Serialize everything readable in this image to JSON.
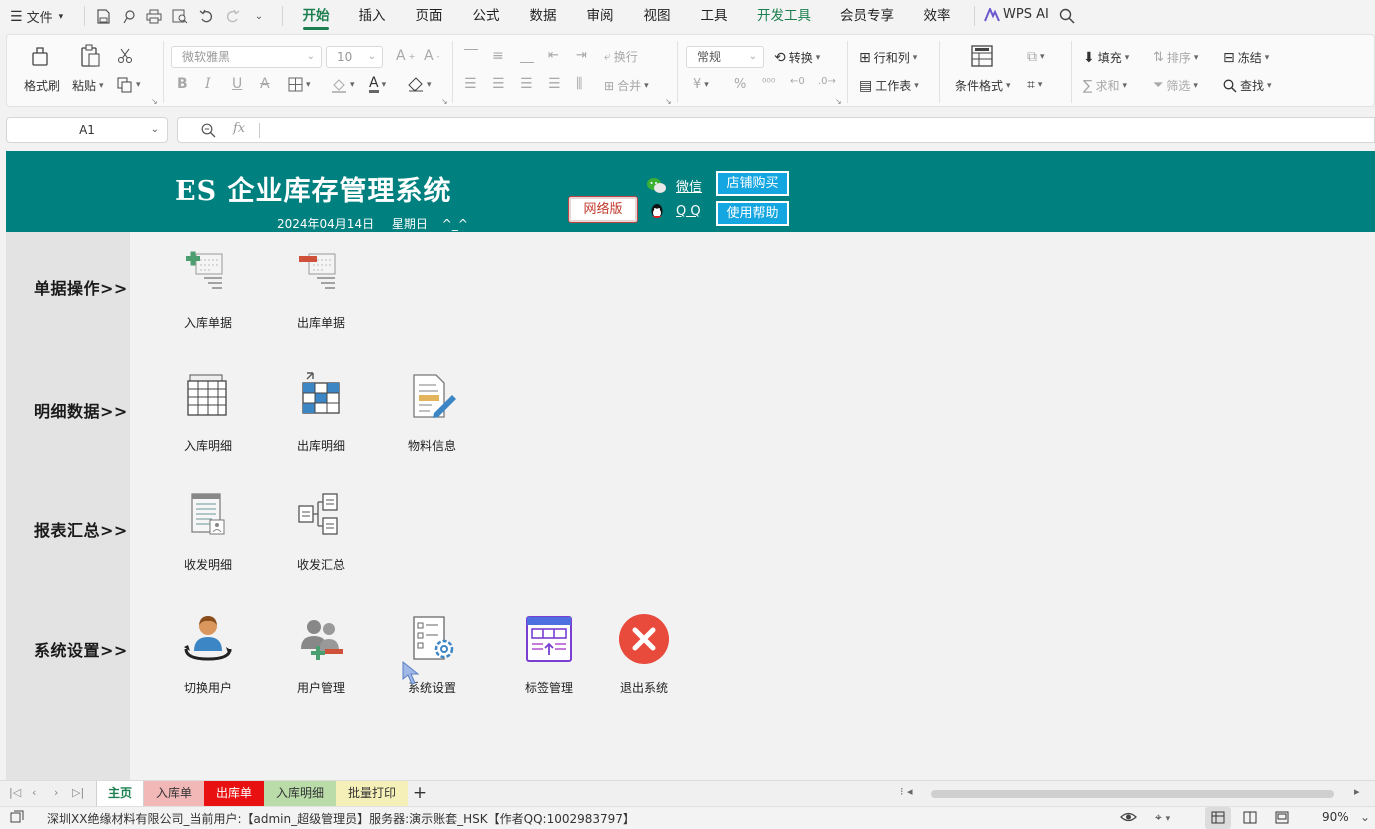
{
  "menubar": {
    "file_label": "文件",
    "tabs": [
      "开始",
      "插入",
      "页面",
      "公式",
      "数据",
      "审阅",
      "视图",
      "工具",
      "开发工具",
      "会员专享",
      "效率"
    ],
    "active_tab": "开始",
    "wps_ai": "WPS AI"
  },
  "ribbon": {
    "format_painter": "格式刷",
    "paste": "粘贴",
    "font_name": "微软雅黑",
    "font_size": "10",
    "wrap": "换行",
    "merge": "合并",
    "number_format": "常规",
    "convert": "转换",
    "rows_cols": "行和列",
    "worksheet": "工作表",
    "cond_format": "条件格式",
    "fill": "填充",
    "sort": "排序",
    "freeze": "冻结",
    "sum": "求和",
    "filter": "筛选",
    "find": "查找",
    "currency_symbol": "¥",
    "percent_symbol": "%"
  },
  "formula": {
    "cell_ref": "A1",
    "fx": "fx"
  },
  "banner": {
    "title": "ES  企业库存管理系统",
    "date": "2024年04月14日",
    "weekday": "星期日",
    "smiley": "^_^",
    "network_button": "网络版",
    "wechat": "微信",
    "qq": "Q Q",
    "shop_button": "店铺购买",
    "help_button": "使用帮助"
  },
  "sections": {
    "documents": {
      "label": "单据操作>>",
      "items": [
        "入库单据",
        "出库单据"
      ]
    },
    "details": {
      "label": "明细数据>>",
      "items": [
        "入库明细",
        "出库明细",
        "物料信息"
      ]
    },
    "reports": {
      "label": "报表汇总>>",
      "items": [
        "收发明细",
        "收发汇总"
      ]
    },
    "settings": {
      "label": "系统设置>>",
      "items": [
        "切换用户",
        "用户管理",
        "系统设置",
        "标签管理",
        "退出系统"
      ]
    }
  },
  "sheet_tabs": [
    {
      "label": "主页",
      "color": "#ffffff"
    },
    {
      "label": "入库单",
      "color": "#f2b8b8"
    },
    {
      "label": "出库单",
      "color": "#e81010"
    },
    {
      "label": "入库明细",
      "color": "#b9dca9"
    },
    {
      "label": "批量打印",
      "color": "#f5efb8"
    }
  ],
  "add_sheet": "+",
  "statusbar": {
    "info": "深圳XX绝缘材料有限公司_当前用户:【admin_超级管理员】服务器:演示账套_HSK【作者QQ:1002983797】",
    "zoom": "90%"
  },
  "colors": {
    "banner": "#00807f",
    "accent": "#1b7f4f",
    "cyan_button": "#13a6e0",
    "exit_red": "#e84a3c"
  }
}
